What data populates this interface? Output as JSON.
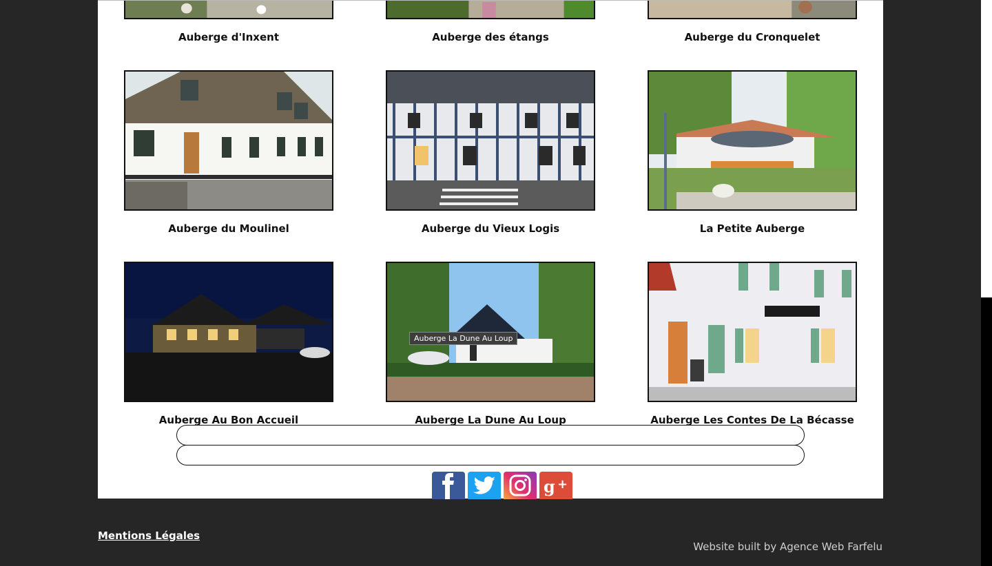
{
  "gallery": {
    "row1_captions": [
      "Auberge d'Inxent",
      "Auberge des étangs",
      "Auberge du Cronquelet"
    ],
    "items": [
      {
        "caption": "Auberge du Moulinel",
        "icon": "photo-white-inn"
      },
      {
        "caption": "Auberge du Vieux Logis",
        "icon": "photo-half-timbered-inn"
      },
      {
        "caption": "La Petite Auberge",
        "icon": "photo-garden-terrace"
      },
      {
        "caption": "Auberge Au Bon Accueil",
        "icon": "photo-inn-at-night"
      },
      {
        "caption": "Auberge La Dune Au Loup",
        "icon": "photo-cottage-with-trees"
      },
      {
        "caption": "Auberge Les Contes De La Bécasse",
        "icon": "photo-restaurant-facade"
      }
    ],
    "tooltip": "Auberge La Dune Au Loup"
  },
  "social": [
    {
      "name": "Facebook",
      "icon": "facebook-icon",
      "color": "#3b5998"
    },
    {
      "name": "Twitter",
      "icon": "twitter-icon",
      "color": "#1da1f2"
    },
    {
      "name": "Instagram",
      "icon": "instagram-icon",
      "color": "#c13584"
    },
    {
      "name": "Google+",
      "icon": "google-plus-icon",
      "color": "#dd4b39"
    }
  ],
  "footer": {
    "legal_link": "Mentions Légales",
    "credit": "Website built by Agence Web Farfelu"
  }
}
